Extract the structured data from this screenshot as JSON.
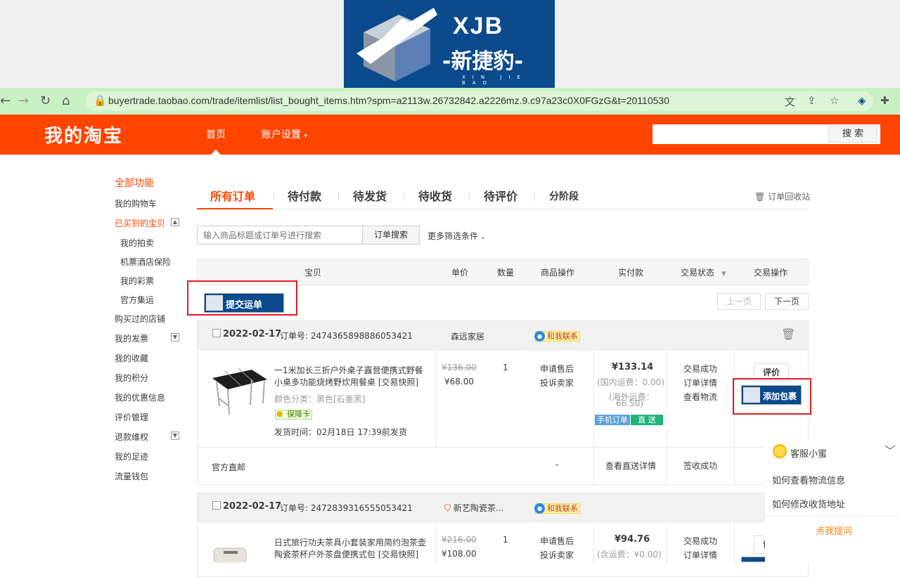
{
  "banner": {
    "logo_main": "XJB",
    "logo_cn": "-新捷豹-",
    "logo_pinyin": "XIN JIE BAO"
  },
  "browser": {
    "url": "buyertrade.taobao.com/trade/itemlist/list_bought_items.htm?spm=a2113w.26732842.a2226mz.9.c97a23c0X0FGzG&t=20110530"
  },
  "header": {
    "brand": "我的淘宝",
    "nav_home": "首页",
    "nav_account": "账户设置",
    "search_placeholder": "",
    "search_button": "搜 索"
  },
  "sidebar": {
    "all_functions": "全部功能",
    "items": [
      "我的购物车",
      "已买到的宝贝",
      "我的拍卖",
      "机票酒店保险",
      "我的彩票",
      "官方集运",
      "购买过的店铺",
      "我的发票",
      "我的收藏",
      "我的积分",
      "我的优惠信息",
      "评价管理",
      "退款维权",
      "我的足迹",
      "流量钱包"
    ]
  },
  "tabs": [
    "所有订单",
    "待付款",
    "待发货",
    "待收货",
    "待评价",
    "分阶段"
  ],
  "recycle_bin": "订单回收站",
  "search": {
    "placeholder": "输入商品标题或订单号进行搜索",
    "button": "订单搜索",
    "more_filters": "更多筛选条件"
  },
  "table_headers": [
    "宝贝",
    "单价",
    "数量",
    "商品操作",
    "实付款",
    "交易状态",
    "交易操作"
  ],
  "submit_waybill": "提交运单",
  "pager": {
    "prev": "上一页",
    "next": "下一页"
  },
  "orders": [
    {
      "date": "2022-02-17",
      "order_no": "订单号: 2474365898886053421",
      "shop": "森远家居",
      "contact": "和我联系",
      "title_line1": "一1米加长三折户外桌子露营便携式野餐",
      "title_line2": "小桌多功能烧烤野炊用餐桌 [交易快照]",
      "color": "颜色分类：黑色[石墨黑]",
      "guarantee": "保障卡",
      "ship_time": "发货时间：02月18日 17:39前发货",
      "original_price": "¥136.00",
      "price": "¥68.00",
      "qty": "1",
      "ops": [
        "申请售后",
        "投诉卖家"
      ],
      "paid": "¥133.14",
      "shipping_domestic": "(国内运费：0.00)",
      "shipping_overseas_l1": "(海外运费：",
      "shipping_overseas_l2": "66.50)",
      "tag_mobile": "手机订单",
      "tag_direct": "直 送",
      "status": [
        "交易成功",
        "订单详情",
        "查看物流"
      ],
      "review": "评价",
      "add_package": "添加包裹",
      "sub_label": "官方直邮",
      "sub_dash": "-",
      "sub_detail": "查看直送详情",
      "sub_status": "签收成功"
    },
    {
      "date": "2022-02-17",
      "order_no": "订单号: 2472839316555053421",
      "shop": "新艺陶瓷茶...",
      "contact": "和我联系",
      "title_line1": "日式旅行功夫茶具小套装家用简约泡茶壶",
      "title_line2": "陶瓷茶杯户外茶盘便携式包 [交易快照]",
      "original_price": "¥216.00",
      "price": "¥108.00",
      "qty": "1",
      "ops": [
        "申请售后",
        "投诉卖家"
      ],
      "paid": "¥94.76",
      "shipping": "(含运费：¥0.00)",
      "status": [
        "交易成功",
        "订单详情"
      ],
      "review": "评价"
    }
  ],
  "chat": {
    "title": "客服小蜜",
    "questions": [
      "如何查看物流信息",
      "如何修改收货地址"
    ],
    "ask": "点我提问"
  },
  "colors": {
    "taobao_orange": "#ff4400",
    "logo_blue": "#0b4a8c",
    "highlight_red": "#e51c23"
  }
}
